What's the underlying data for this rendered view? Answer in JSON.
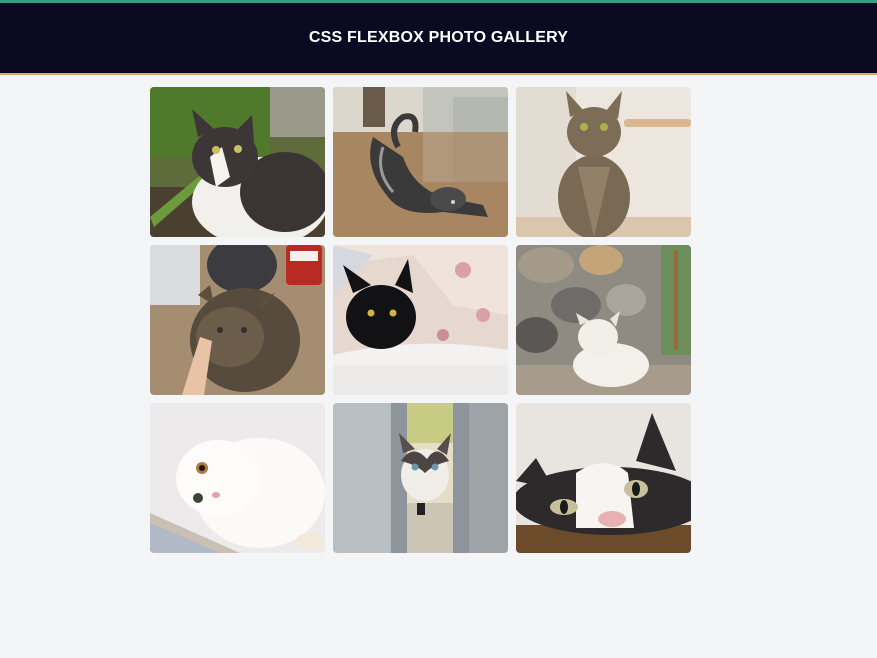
{
  "header": {
    "title": "CSS FLEXBOX PHOTO GALLERY"
  },
  "gallery": {
    "photos": [
      {
        "icon": "cat-in-garden-photo",
        "subject": "tuxedo cat in garden grass"
      },
      {
        "icon": "cat-stretching-photo",
        "subject": "tabby cat stretching on floor"
      },
      {
        "icon": "cat-sitting-photo",
        "subject": "brown tabby cat sitting"
      },
      {
        "icon": "cat-sniffing-finger-photo",
        "subject": "tabby cat sniffing finger"
      },
      {
        "icon": "black-cat-basket-photo",
        "subject": "black cat in laundry basket"
      },
      {
        "icon": "white-cat-rocks-photo",
        "subject": "white cat on stone wall"
      },
      {
        "icon": "fluffy-white-kitten-photo",
        "subject": "fluffy white kitten"
      },
      {
        "icon": "cat-in-window-photo",
        "subject": "cat peeking through door"
      },
      {
        "icon": "cat-face-closeup-photo",
        "subject": "black and white cat face"
      }
    ]
  }
}
